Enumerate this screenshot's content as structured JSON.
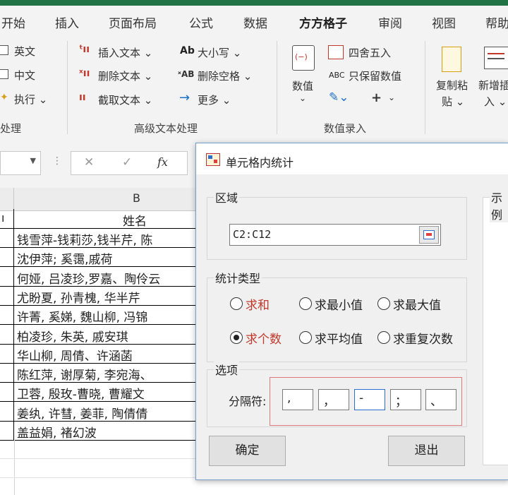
{
  "ribbon_tabs": [
    "开始",
    "插入",
    "页面布局",
    "公式",
    "数据",
    "方方格子",
    "审阅",
    "视图",
    "帮助"
  ],
  "ribbon": {
    "left_group": {
      "items": [
        "英文",
        "中文",
        "执行 ⌄"
      ],
      "label": "处理"
    },
    "text_group": {
      "col1": [
        "插入文本 ⌄",
        "删除文本 ⌄",
        "截取文本 ⌄"
      ],
      "col2": [
        "大小写 ⌄",
        "删除空格 ⌄",
        "更多 ⌄"
      ],
      "label": "高级文本处理",
      "col2_icons": [
        "Ab",
        "ˣAB",
        "→"
      ]
    },
    "num_group": {
      "big_label": "数值",
      "round": "四舍五入",
      "keep": "只保留数值",
      "plus": "+",
      "label": "数值录入",
      "keep_icon": "ABC"
    },
    "right_group": {
      "copy_paste": [
        "复制粘",
        "贴 ⌄"
      ],
      "new_insert": [
        "新增插",
        "入 ⌄"
      ]
    }
  },
  "formula_bar": {
    "fx": "fx",
    "cancel": "✕",
    "enter": "✓"
  },
  "sheet": {
    "col_b": "B",
    "header_name": "姓名",
    "rows": [
      "钱雪萍-钱莉莎,钱半芹, 陈",
      "沈伊萍; 奚霭,戚荷",
      "何娅, 吕凌珍,罗嘉、陶伶云",
      "尤盼夏, 孙青槐, 华半芹",
      "许菁, 奚娣, 魏山柳, 冯锦",
      "柏凌珍, 朱英, 戚安琪",
      "华山柳, 周倩、许涵菡",
      "陈红萍, 谢厚菊, 李宛海、",
      "卫蓉, 殷玫-曹晓, 曹耀文",
      "姜纨, 许彗, 姜菲, 陶倩倩",
      "盖益娟, 褚幻波"
    ]
  },
  "dialog": {
    "title": "单元格内统计",
    "region_label": "区域",
    "range_value": "C2:C12",
    "stat_label": "统计类型",
    "options": [
      "求和",
      "求最小值",
      "求最大值",
      "求个数",
      "求平均值",
      "求重复次数"
    ],
    "selected_option": "求个数",
    "preview_label": "示例",
    "sep_group_label": "选项",
    "sep_label": "分隔符:",
    "separators": [
      ",",
      "，",
      "-",
      "；",
      "、"
    ],
    "ok": "确定",
    "exit": "退出"
  },
  "colors": {
    "excel_green": "#217346",
    "highlight_red": "#c0392b",
    "sep_border": "#e07a7a"
  }
}
